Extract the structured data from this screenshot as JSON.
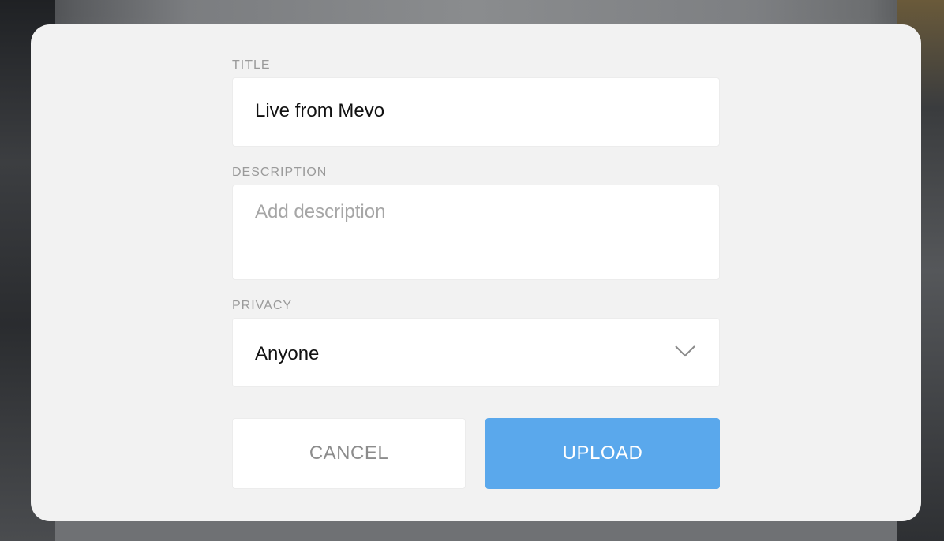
{
  "form": {
    "title": {
      "label": "TITLE",
      "value": "Live from Mevo"
    },
    "description": {
      "label": "DESCRIPTION",
      "placeholder": "Add description",
      "value": ""
    },
    "privacy": {
      "label": "PRIVACY",
      "selected": "Anyone"
    }
  },
  "buttons": {
    "cancel_label": "CANCEL",
    "upload_label": "UPLOAD"
  },
  "colors": {
    "accent": "#5aa8ec",
    "dialog_bg": "#f2f2f2",
    "label": "#9a9a9a",
    "placeholder": "#a6a6a6"
  },
  "icons": {
    "privacy_dropdown": "chevron-down-icon"
  }
}
